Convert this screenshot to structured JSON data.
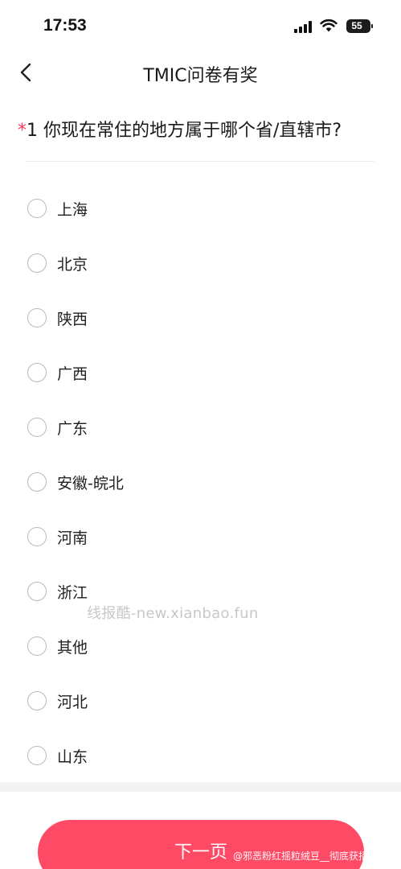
{
  "status_bar": {
    "time": "17:53",
    "battery": "55"
  },
  "nav": {
    "title": "TMIC问卷有奖",
    "back_icon": "chevron-left-icon"
  },
  "question": {
    "required_mark": "*",
    "text": "1 你现在常住的地方属于哪个省/直辖市?"
  },
  "options": [
    {
      "label": "上海"
    },
    {
      "label": "北京"
    },
    {
      "label": "陕西"
    },
    {
      "label": "广西"
    },
    {
      "label": "广东"
    },
    {
      "label": "安徽-皖北"
    },
    {
      "label": "河南"
    },
    {
      "label": "浙江"
    },
    {
      "label": "其他"
    },
    {
      "label": "河北"
    },
    {
      "label": "山东"
    }
  ],
  "watermark": "线报酷-new.xianbao.fun",
  "footer": {
    "next_label": "下一页",
    "credit": "@邪恶粉红摇粒绒豆__彻底获招版"
  },
  "colors": {
    "accent": "#ff4a66",
    "required": "#ff3a5a"
  }
}
